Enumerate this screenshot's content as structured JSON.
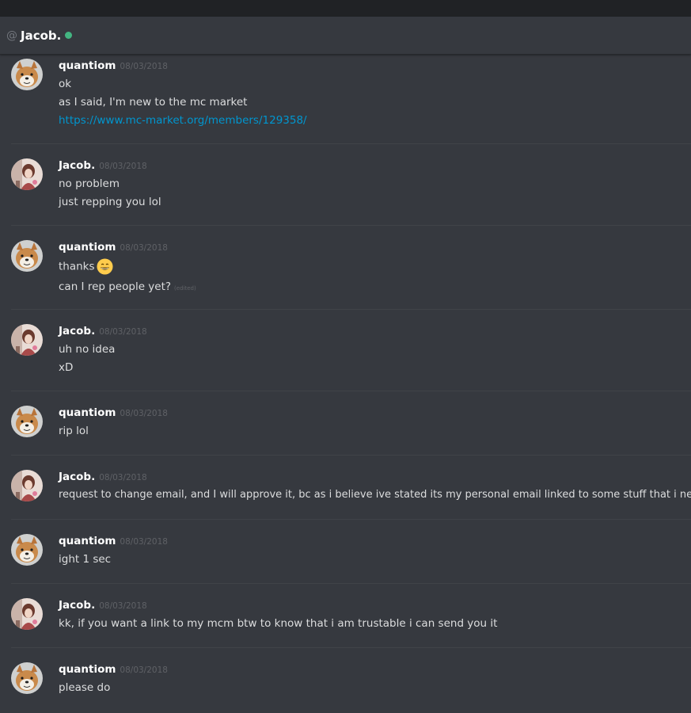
{
  "header": {
    "at_symbol": "@",
    "name": "Jacob."
  },
  "icons": {
    "at": "at-icon",
    "status": "online-status-icon",
    "emoji": "grinning-face-emoji"
  },
  "colors": {
    "background": "#36393f",
    "titlebar": "#202225",
    "online": "#43b581",
    "link": "#0096cf"
  },
  "messages": [
    {
      "author": "quantiom",
      "timestamp": "08/03/2018",
      "lines": [
        "ok",
        "as I said, I'm new to the mc market",
        "https://www.mc-market.org/members/129358/"
      ]
    },
    {
      "author": "Jacob.",
      "timestamp": "08/03/2018",
      "lines": [
        "no problem",
        "just repping you lol"
      ]
    },
    {
      "author": "quantiom",
      "timestamp": "08/03/2018",
      "lines": [
        "thanks",
        "can I rep people yet?"
      ],
      "edited_label": "(edited)"
    },
    {
      "author": "Jacob.",
      "timestamp": "08/03/2018",
      "lines": [
        "uh no idea",
        "xD"
      ]
    },
    {
      "author": "quantiom",
      "timestamp": "08/03/2018",
      "lines": [
        "rip lol"
      ]
    },
    {
      "author": "Jacob.",
      "timestamp": "08/03/2018",
      "lines": [
        "request to change email, and I will approve it, bc as i believe ive stated its my personal email linked to some stuff that i need lol"
      ]
    },
    {
      "author": "quantiom",
      "timestamp": "08/03/2018",
      "lines": [
        "ight 1 sec"
      ]
    },
    {
      "author": "Jacob.",
      "timestamp": "08/03/2018",
      "lines": [
        "kk, if you want a link to my mcm btw to know that i am trustable i can send you it"
      ]
    },
    {
      "author": "quantiom",
      "timestamp": "08/03/2018",
      "lines": [
        "please do"
      ]
    }
  ]
}
